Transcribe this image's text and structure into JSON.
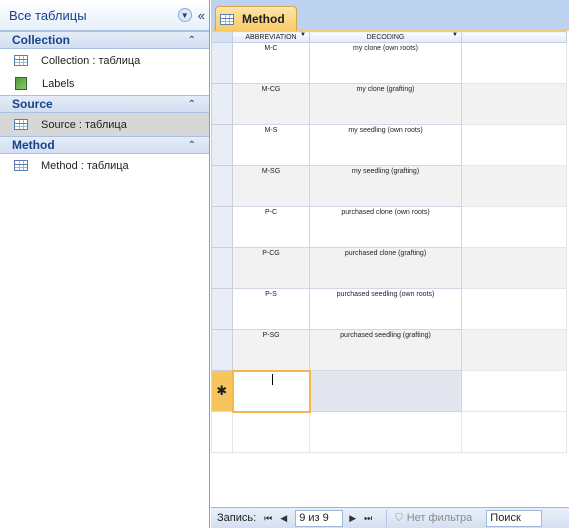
{
  "nav": {
    "title": "Все таблицы",
    "groups": [
      {
        "title": "Collection",
        "items": [
          {
            "label": "Collection : таблица",
            "icon": "table-icon"
          },
          {
            "label": "Labels",
            "icon": "report-icon"
          }
        ]
      },
      {
        "title": "Source",
        "items": [
          {
            "label": "Source : таблица",
            "icon": "table-icon",
            "selected": true
          }
        ]
      },
      {
        "title": "Method",
        "items": [
          {
            "label": "Method : таблица",
            "icon": "table-icon"
          }
        ]
      }
    ]
  },
  "tab": {
    "label": "Method"
  },
  "grid": {
    "columns": [
      "ABBREVIATION",
      "DECODING"
    ],
    "rows": [
      [
        "M-C",
        "my clone (own roots)"
      ],
      [
        "M-CG",
        "my clone (grafting)"
      ],
      [
        "M-S",
        "my seedling (own roots)"
      ],
      [
        "M-SG",
        "my seedling (grafting)"
      ],
      [
        "P-C",
        "purchased clone (own roots)"
      ],
      [
        "P-CG",
        "purchased clone (grafting)"
      ],
      [
        "P-S",
        "purchased seedling (own roots)"
      ],
      [
        "P-SG",
        "purchased seedling (grafting)"
      ]
    ],
    "new_record_marker": "✱"
  },
  "navbar": {
    "record_label": "Запись:",
    "first": "⏮",
    "prev": "◀",
    "record_value": "9 из 9",
    "next": "▶",
    "last": "⏭",
    "filter_label": "Нет фильтра",
    "search_label": "Поиск"
  },
  "colors": {
    "accent": "#15428b",
    "tab": "#f9c966",
    "nav_border": "#7da2ce"
  }
}
